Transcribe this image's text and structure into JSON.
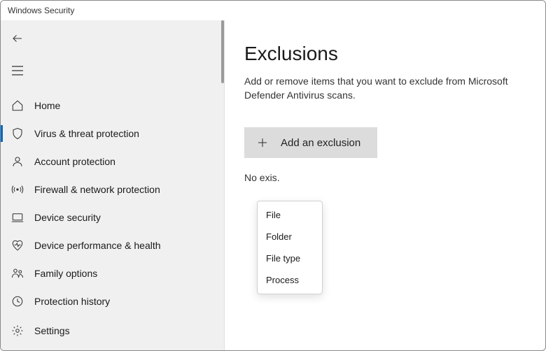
{
  "window": {
    "title": "Windows Security"
  },
  "sidebar": {
    "items": [
      {
        "label": "Home"
      },
      {
        "label": "Virus & threat protection"
      },
      {
        "label": "Account protection"
      },
      {
        "label": "Firewall & network protection"
      },
      {
        "label": "Device security"
      },
      {
        "label": "Device performance & health"
      },
      {
        "label": "Family options"
      },
      {
        "label": "Protection history"
      }
    ],
    "settings_label": "Settings"
  },
  "content": {
    "heading": "Exclusions",
    "description": "Add or remove items that you want to exclude from Microsoft Defender Antivirus scans.",
    "add_button": "Add an exclusion",
    "status_prefix": "No exis",
    "status_suffix": "."
  },
  "dropdown": {
    "items": [
      {
        "label": "File"
      },
      {
        "label": "Folder"
      },
      {
        "label": "File type"
      },
      {
        "label": "Process"
      }
    ]
  }
}
